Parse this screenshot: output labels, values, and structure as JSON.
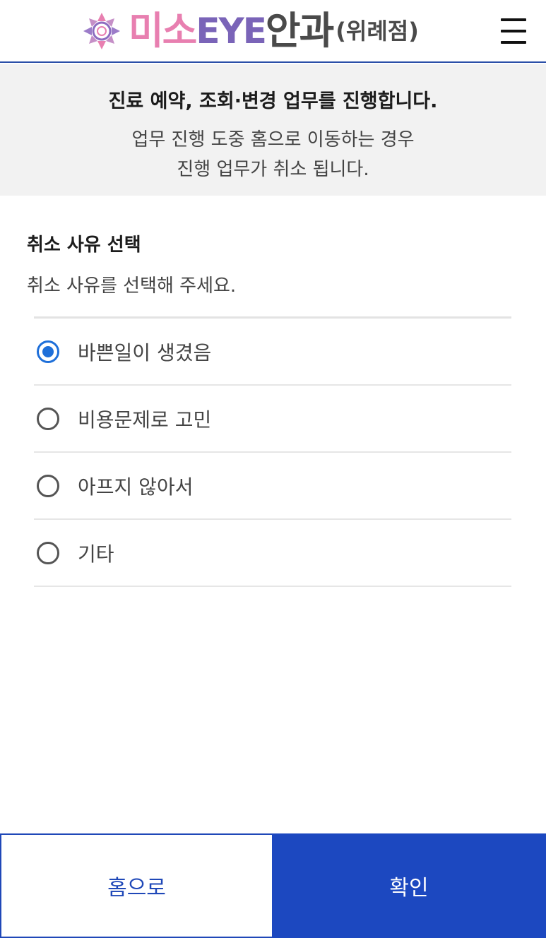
{
  "header": {
    "logo": {
      "miso": "미소",
      "eye": "EYE",
      "an": "안과",
      "branch": "(위례점)",
      "mark_icon": "flower-logo-icon",
      "colors": {
        "miso": "#e87fb0",
        "eye": "#7a64b8",
        "an": "#4a4a4a"
      }
    },
    "menu_icon": "hamburger-menu-icon"
  },
  "notice": {
    "title": "진료 예약, 조회·변경 업무를 진행합니다.",
    "body": "업무 진행 도중 홈으로 이동하는 경우 진행 업무가 취소 됩니다."
  },
  "section": {
    "title": "취소 사유 선택",
    "description": "취소 사유를 선택해 주세요."
  },
  "reasons": [
    {
      "label": "바쁜일이 생겼음",
      "selected": true
    },
    {
      "label": "비용문제로 고민",
      "selected": false
    },
    {
      "label": "아프지 않아서",
      "selected": false
    },
    {
      "label": "기타",
      "selected": false
    }
  ],
  "buttons": {
    "home_label": "홈으로",
    "confirm_label": "확인"
  },
  "colors": {
    "accent": "#1c48c0",
    "radio_selected": "#1e6fd9",
    "header_border": "#2b4fa8",
    "notice_bg": "#f2f2f2"
  }
}
